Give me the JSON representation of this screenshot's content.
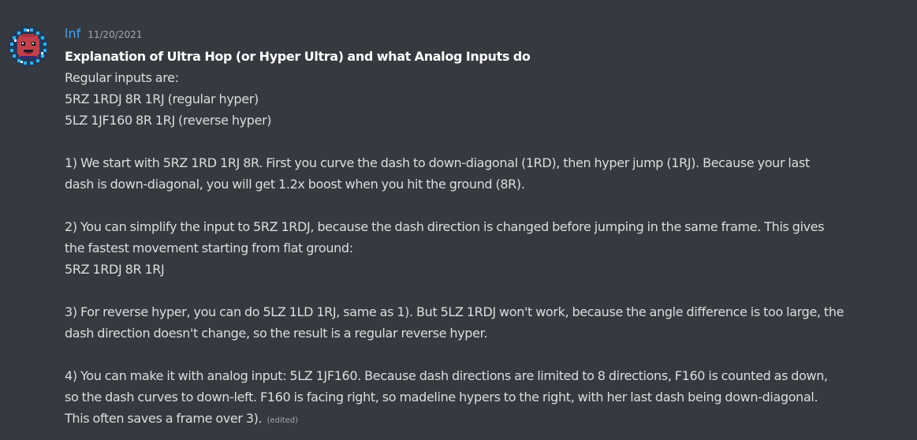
{
  "message": {
    "author": "lnf",
    "timestamp": "11/20/2021",
    "avatar": {
      "icon": "pixel-avatar-icon",
      "colors": {
        "ring": "#36b0e6",
        "face": "#c2404a",
        "bg": "#203c5c"
      }
    },
    "title": "Explanation of Ultra Hop (or Hyper Ultra) and what Analog Inputs do",
    "lines": [
      "Regular inputs are:",
      "5RZ 1RDJ 8R 1RJ (regular hyper)",
      "5LZ 1JF160 8R 1RJ (reverse hyper)",
      "",
      "1) We start with 5RZ 1RD 1RJ 8R. First you curve the dash to down-diagonal (1RD), then hyper jump (1RJ). Because your last",
      "dash is down-diagonal, you will get 1.2x boost when you hit the ground (8R).",
      "",
      "2) You can simplify the input to 5RZ 1RDJ, because the dash direction is changed before jumping in the same frame. This gives",
      "the fastest movement starting from flat ground:",
      "5RZ 1RDJ 8R 1RJ",
      "",
      "3) For reverse hyper, you can do 5LZ 1LD 1RJ, same as 1). But 5LZ 1RDJ won't work, because the angle difference is too large, the",
      "dash direction doesn't change, so the result is a regular reverse hyper.",
      "",
      "4) You can make it with analog input: 5LZ 1JF160. Because dash directions are limited to 8 directions, F160 is counted as down,",
      "so the dash curves to down-left. F160 is facing right, so madeline hypers to the right, with her last dash being down-diagonal.",
      "This often saves a frame over 3)."
    ],
    "edited_label": "(edited)"
  },
  "colors": {
    "background": "#36393f",
    "username": "#3ba5ff",
    "text": "#dcddde",
    "muted": "#a3a6aa"
  }
}
